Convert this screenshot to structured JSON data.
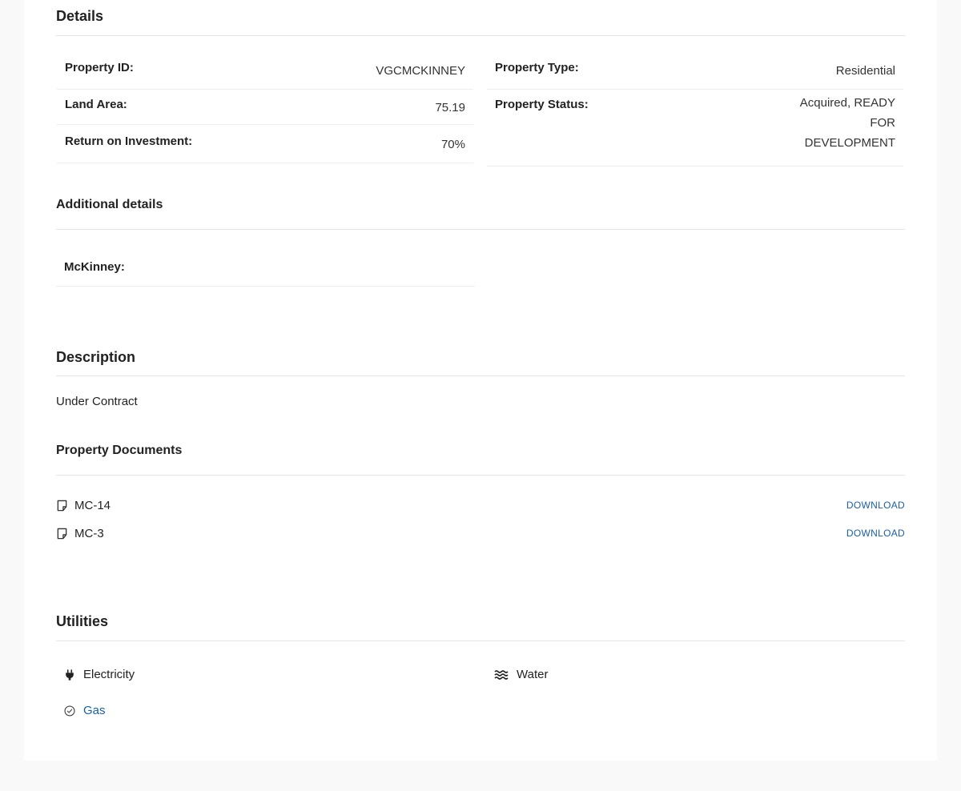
{
  "details": {
    "title": "Details",
    "left": [
      {
        "label": "Property ID:",
        "value": "VGCMCKINNEY"
      },
      {
        "label": "Land Area:",
        "value": "75.19"
      },
      {
        "label": "Return on Investment:",
        "value": "70%"
      }
    ],
    "right": [
      {
        "label": "Property Type:",
        "value": "Residential"
      },
      {
        "label": "Property Status:",
        "value_lines": [
          "Acquired, READY",
          "FOR",
          "DEVELOPMENT"
        ]
      }
    ]
  },
  "additional": {
    "title": "Additional details",
    "items": [
      {
        "label": "McKinney:",
        "value": ""
      }
    ]
  },
  "description": {
    "title": "Description",
    "text": "Under Contract"
  },
  "documents": {
    "title": "Property Documents",
    "items": [
      {
        "name": "MC-14",
        "action": "DOWNLOAD"
      },
      {
        "name": "MC-3",
        "action": "DOWNLOAD"
      }
    ]
  },
  "utilities": {
    "title": "Utilities",
    "items": [
      {
        "name": "Electricity",
        "icon": "plug-icon"
      },
      {
        "name": "Water",
        "icon": "water-icon"
      },
      {
        "name": "Gas",
        "icon": "check-circle-icon"
      }
    ],
    "link_color": "#1a5fa8"
  }
}
